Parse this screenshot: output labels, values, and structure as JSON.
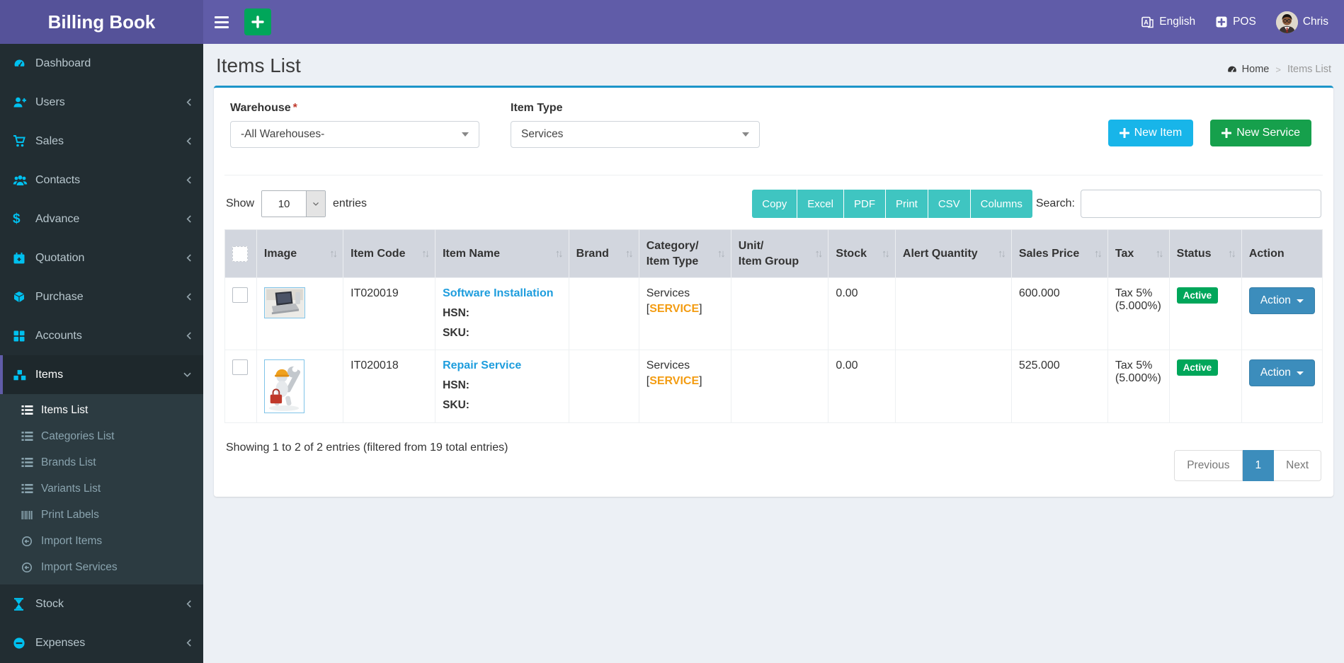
{
  "app": {
    "title": "Billing Book"
  },
  "topbar": {
    "language": "English",
    "pos_label": "POS",
    "username": "Chris"
  },
  "sidebar": {
    "items": [
      {
        "label": "Dashboard"
      },
      {
        "label": "Users"
      },
      {
        "label": "Sales"
      },
      {
        "label": "Contacts"
      },
      {
        "label": "Advance"
      },
      {
        "label": "Quotation"
      },
      {
        "label": "Purchase"
      },
      {
        "label": "Accounts"
      },
      {
        "label": "Items"
      },
      {
        "label": "Stock"
      },
      {
        "label": "Expenses"
      }
    ],
    "items_submenu": [
      {
        "label": "Items List"
      },
      {
        "label": "Categories List"
      },
      {
        "label": "Brands List"
      },
      {
        "label": "Variants List"
      },
      {
        "label": "Print Labels"
      },
      {
        "label": "Import Items"
      },
      {
        "label": "Import Services"
      }
    ]
  },
  "page": {
    "title": "Items List",
    "breadcrumb": {
      "home": "Home",
      "sep": ">",
      "current": "Items List"
    }
  },
  "filters": {
    "warehouse": {
      "label": "Warehouse",
      "required": "*",
      "value": "-All Warehouses-"
    },
    "item_type": {
      "label": "Item Type",
      "value": "Services"
    },
    "new_item": "New Item",
    "new_service": "New Service"
  },
  "controls": {
    "show": "Show",
    "length": "10",
    "entries": "entries",
    "buttons": [
      "Copy",
      "Excel",
      "PDF",
      "Print",
      "CSV",
      "Columns"
    ],
    "search": "Search:"
  },
  "table": {
    "headers": [
      {
        "t": "Image"
      },
      {
        "t": "Item Code"
      },
      {
        "t": "Item Name"
      },
      {
        "t": "Brand"
      },
      {
        "t": "Category/",
        "t2": "Item Type"
      },
      {
        "t": "Unit/",
        "t2": "Item Group"
      },
      {
        "t": "Stock"
      },
      {
        "t": "Alert Quantity"
      },
      {
        "t": "Sales Price"
      },
      {
        "t": "Tax"
      },
      {
        "t": "Status"
      },
      {
        "t": "Action"
      }
    ],
    "rows": [
      {
        "code": "IT020019",
        "name": "Software Installation",
        "hsn": "HSN:",
        "sku": "SKU:",
        "category": "Services",
        "tag_l": "[",
        "tag": "SERVICE",
        "tag_r": "]",
        "stock": "0.00",
        "alert_quantity": "",
        "price": "600.000",
        "tax1": "Tax 5%",
        "tax2": "(5.000%)",
        "status": "Active",
        "action": "Action"
      },
      {
        "code": "IT020018",
        "name": "Repair Service",
        "hsn": "HSN:",
        "sku": "SKU:",
        "category": "Services",
        "tag_l": "[",
        "tag": "SERVICE",
        "tag_r": "]",
        "stock": "0.00",
        "alert_quantity": "",
        "price": "525.000",
        "tax1": "Tax 5%",
        "tax2": "(5.000%)",
        "status": "Active",
        "action": "Action"
      }
    ]
  },
  "footer": {
    "summary": "Showing 1 to 2 of 2 entries (filtered from 19 total entries)",
    "previous": "Previous",
    "page": "1",
    "next": "Next"
  },
  "colors": {
    "topbar_purple": "#605ca8",
    "logo_purple": "#555299",
    "sidebar_dark": "#222d32",
    "icon_cyan": "#00c0ef",
    "card_top_border": "#1c95c9",
    "teal_button": "#3fc5c1",
    "new_item_blue": "#18b5e9",
    "new_service_green": "#16a04c",
    "action_blue": "#3c8dbc",
    "badge_green": "#00a65a",
    "link_blue": "#1e9ddd",
    "tag_orange": "#f39c12"
  }
}
